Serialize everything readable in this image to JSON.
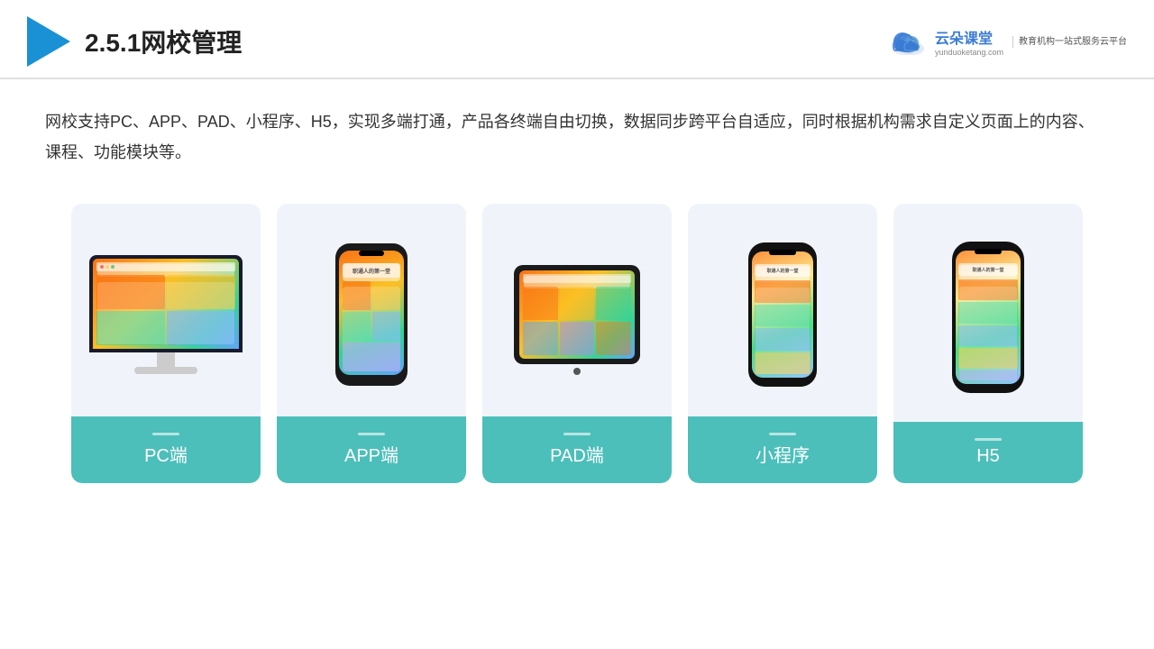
{
  "header": {
    "title": "2.5.1网校管理",
    "brand": {
      "name": "云朵课堂",
      "url": "yunduoketang.com",
      "tagline": "教育机构一站式服务云平台"
    }
  },
  "description": {
    "text": "网校支持PC、APP、PAD、小程序、H5，实现多端打通，产品各终端自由切换，数据同步跨平台自适应，同时根据机构需求自定义页面上的内容、课程、功能模块等。"
  },
  "cards": [
    {
      "id": "pc",
      "label": "PC端"
    },
    {
      "id": "app",
      "label": "APP端"
    },
    {
      "id": "pad",
      "label": "PAD端"
    },
    {
      "id": "miniprogram",
      "label": "小程序"
    },
    {
      "id": "h5",
      "label": "H5"
    }
  ],
  "colors": {
    "accent": "#4cbfba",
    "header_border": "#e0e0e0",
    "card_bg": "#f0f4fa",
    "brand_blue": "#3a7bd5"
  }
}
